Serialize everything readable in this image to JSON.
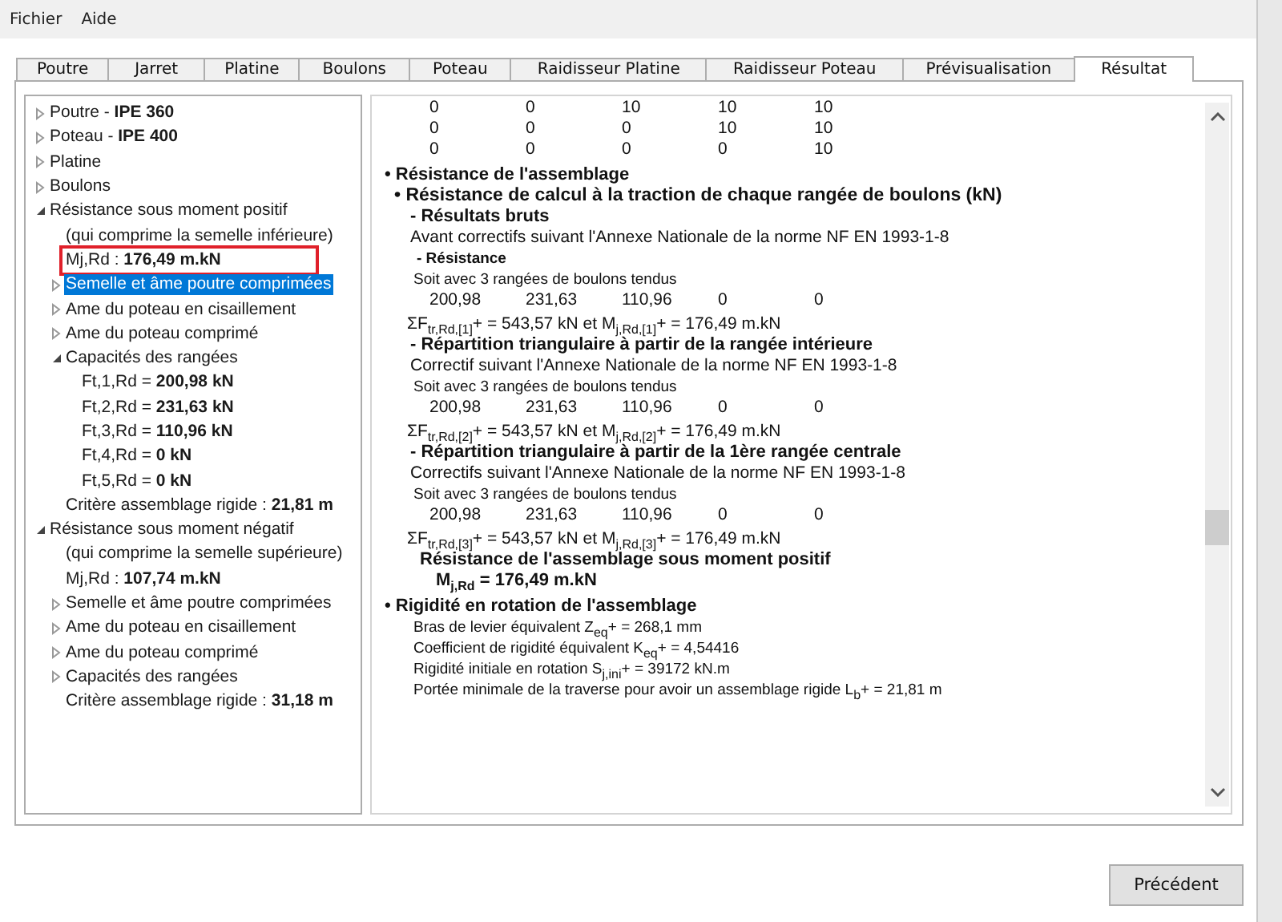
{
  "menu": [
    {
      "label": "Fichier"
    },
    {
      "label": "Aide"
    }
  ],
  "tabs": [
    {
      "label": "Poutre",
      "selected": false
    },
    {
      "label": "Jarret",
      "selected": false
    },
    {
      "label": "Platine",
      "selected": false
    },
    {
      "label": "Boulons",
      "selected": false
    },
    {
      "label": "Poteau",
      "selected": false
    },
    {
      "label": "Raidisseur Platine",
      "selected": false
    },
    {
      "label": "Raidisseur Poteau",
      "selected": false
    },
    {
      "label": "Prévisualisation",
      "selected": false
    },
    {
      "label": "Résultat",
      "selected": true
    }
  ],
  "tree": [
    {
      "kind": "node",
      "text": "Poutre - **IPE 360**",
      "expanded": false,
      "selected": false,
      "outlined": false
    },
    {
      "kind": "node",
      "text": "Poteau - **IPE 400**",
      "expanded": false,
      "selected": false,
      "outlined": false
    },
    {
      "kind": "node",
      "text": "Platine",
      "expanded": false,
      "selected": false,
      "outlined": false
    },
    {
      "kind": "node",
      "text": "Boulons",
      "expanded": false,
      "selected": false,
      "outlined": false
    },
    {
      "kind": "node",
      "text": "Résistance sous moment positif",
      "expanded": true,
      "selected": false,
      "outlined": false,
      "children": [
        {
          "kind": "leaf",
          "text": "(qui comprime la semelle inférieure)",
          "selected": false,
          "outlined": false
        },
        {
          "kind": "leaf",
          "text": "Mj,Rd : **176,49 m.kN**",
          "selected": false,
          "outlined": true
        },
        {
          "kind": "node",
          "text": "Semelle et âme poutre comprimées",
          "expanded": false,
          "selected": true,
          "outlined": false
        },
        {
          "kind": "node",
          "text": "Ame du poteau en cisaillement",
          "expanded": false,
          "selected": false,
          "outlined": false
        },
        {
          "kind": "node",
          "text": "Ame du poteau comprimé",
          "expanded": false,
          "selected": false,
          "outlined": false
        },
        {
          "kind": "node",
          "text": "Capacités des rangées",
          "expanded": true,
          "selected": false,
          "outlined": false,
          "children": [
            {
              "kind": "leaf",
              "text": "Ft,1,Rd = **200,98 kN**",
              "selected": false,
              "outlined": false
            },
            {
              "kind": "leaf",
              "text": "Ft,2,Rd = **231,63 kN**",
              "selected": false,
              "outlined": false
            },
            {
              "kind": "leaf",
              "text": "Ft,3,Rd = **110,96 kN**",
              "selected": false,
              "outlined": false
            },
            {
              "kind": "leaf",
              "text": "Ft,4,Rd = **0 kN**",
              "selected": false,
              "outlined": false
            },
            {
              "kind": "leaf",
              "text": "Ft,5,Rd = **0 kN**",
              "selected": false,
              "outlined": false
            }
          ]
        },
        {
          "kind": "leaf",
          "text": "Critère assemblage rigide : **21,81 m**",
          "selected": false,
          "outlined": false
        }
      ]
    },
    {
      "kind": "node",
      "text": "Résistance sous moment négatif",
      "expanded": true,
      "selected": false,
      "outlined": false,
      "children": [
        {
          "kind": "leaf",
          "text": "(qui comprime la semelle supérieure)",
          "selected": false,
          "outlined": false
        },
        {
          "kind": "leaf",
          "text": "Mj,Rd : **107,74 m.kN**",
          "selected": false,
          "outlined": false
        },
        {
          "kind": "node",
          "text": "Semelle et âme poutre comprimées",
          "expanded": false,
          "selected": false,
          "outlined": false
        },
        {
          "kind": "node",
          "text": "Ame du poteau en cisaillement",
          "expanded": false,
          "selected": false,
          "outlined": false
        },
        {
          "kind": "node",
          "text": "Ame du poteau comprimé",
          "expanded": false,
          "selected": false,
          "outlined": false
        },
        {
          "kind": "node",
          "text": "Capacités des rangées",
          "expanded": false,
          "selected": false,
          "outlined": false
        },
        {
          "kind": "leaf",
          "text": "Critère assemblage rigide : **31,18 m**",
          "selected": false,
          "outlined": false
        }
      ]
    }
  ],
  "report": [
    {
      "kind": "values",
      "values": [
        "0",
        "0",
        "10",
        "10",
        "10"
      ]
    },
    {
      "kind": "values",
      "values": [
        "0",
        "0",
        "0",
        "10",
        "10"
      ]
    },
    {
      "kind": "values",
      "values": [
        "0",
        "0",
        "0",
        "0",
        "10"
      ]
    },
    {
      "kind": "h1",
      "text": "• Résistance de l'assemblage"
    },
    {
      "kind": "h2",
      "text": "• Résistance de calcul à la traction de chaque rangée de boulons (kN)"
    },
    {
      "kind": "h3",
      "text": "- Résultats bruts"
    },
    {
      "kind": "text",
      "text": "Avant correctifs suivant l'Annexe Nationale de la norme NF EN 1993-1-8"
    },
    {
      "kind": "h4",
      "text": "- Résistance"
    },
    {
      "kind": "small",
      "text": "Soit avec 3 rangées de boulons tendus"
    },
    {
      "kind": "values",
      "values": [
        "200,98",
        "231,63",
        "110,96",
        "0",
        "0"
      ]
    },
    {
      "kind": "sum",
      "text": "ΣF$_{tr,Rd,[1]}$+ = 543,57 kN et M$_{j,Rd,[1]}$+ = 176,49 m.kN"
    },
    {
      "kind": "h3",
      "text": "- Répartition triangulaire à partir de la rangée intérieure"
    },
    {
      "kind": "text",
      "text": "Correctif suivant l'Annexe Nationale de la norme NF EN 1993-1-8"
    },
    {
      "kind": "small",
      "text": "Soit avec 3 rangées de boulons tendus"
    },
    {
      "kind": "values",
      "values": [
        "200,98",
        "231,63",
        "110,96",
        "0",
        "0"
      ]
    },
    {
      "kind": "sum",
      "text": "ΣF$_{tr,Rd,[2]}$+ = 543,57 kN et M$_{j,Rd,[2]}$+ = 176,49 m.kN"
    },
    {
      "kind": "h3",
      "text": "- Répartition triangulaire à partir de la 1ère rangée centrale"
    },
    {
      "kind": "text",
      "text": "Correctifs suivant l'Annexe Nationale de la norme NF EN 1993-1-8"
    },
    {
      "kind": "small",
      "text": "Soit avec 3 rangées de boulons tendus"
    },
    {
      "kind": "values",
      "values": [
        "200,98",
        "231,63",
        "110,96",
        "0",
        "0"
      ]
    },
    {
      "kind": "sum",
      "text": "ΣF$_{tr,Rd,[3]}$+ = 543,57 kN et M$_{j,Rd,[3]}$+ = 176,49 m.kN"
    },
    {
      "kind": "result",
      "text": "Résistance de l'assemblage sous moment positif"
    },
    {
      "kind": "result_value",
      "text": "M$_{j,Rd}$ = 176,49 m.kN"
    },
    {
      "kind": "h1",
      "text": "• Rigidité en rotation de l'assemblage"
    },
    {
      "kind": "small",
      "text": "Bras de levier équivalent Z$_{eq}$+ = 268,1 mm"
    },
    {
      "kind": "small",
      "text": "Coefficient de rigidité équivalent K$_{eq}$+ = 4,54416"
    },
    {
      "kind": "small",
      "text": "Rigidité initiale en rotation S$_{j,ini}$+ = 39172 kN.m"
    },
    {
      "kind": "small",
      "text": "Portée minimale de la traverse pour avoir un assemblage rigide L$_{b}$+ = 21,81 m"
    }
  ],
  "buttons": [
    {
      "label": "Précédent"
    }
  ]
}
